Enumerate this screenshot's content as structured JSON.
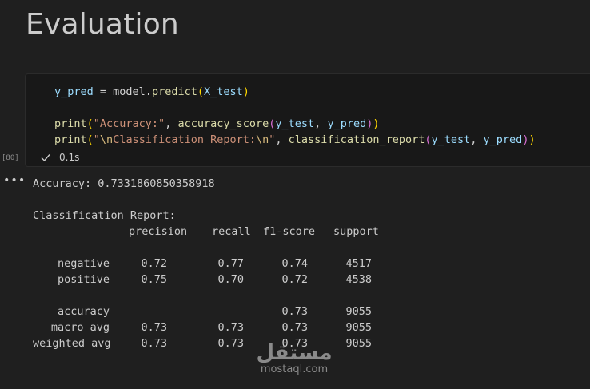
{
  "heading": "Evaluation",
  "cell": {
    "code_lines": [
      [
        [
          "var",
          "y_pred"
        ],
        [
          "txt",
          " = model."
        ],
        [
          "fn",
          "predict"
        ],
        [
          "p1",
          "("
        ],
        [
          "var",
          "X_test"
        ],
        [
          "p1",
          ")"
        ]
      ],
      [],
      [
        [
          "fn",
          "print"
        ],
        [
          "p1",
          "("
        ],
        [
          "str",
          "\"Accuracy:\""
        ],
        [
          "txt",
          ", "
        ],
        [
          "fn",
          "accuracy_score"
        ],
        [
          "p2",
          "("
        ],
        [
          "var",
          "y_test"
        ],
        [
          "txt",
          ", "
        ],
        [
          "var",
          "y_pred"
        ],
        [
          "p2",
          ")"
        ],
        [
          "p1",
          ")"
        ]
      ],
      [
        [
          "fn",
          "print"
        ],
        [
          "p1",
          "("
        ],
        [
          "str",
          "\""
        ],
        [
          "esc",
          "\\n"
        ],
        [
          "str",
          "Classification Report:"
        ],
        [
          "esc",
          "\\n"
        ],
        [
          "str",
          "\""
        ],
        [
          "txt",
          ", "
        ],
        [
          "fn",
          "classification_report"
        ],
        [
          "p2",
          "("
        ],
        [
          "var",
          "y_test"
        ],
        [
          "txt",
          ", "
        ],
        [
          "var",
          "y_pred"
        ],
        [
          "p2",
          ")"
        ],
        [
          "p1",
          ")"
        ]
      ]
    ],
    "execution_count": "[80]",
    "duration": "0.1s"
  },
  "output": {
    "accuracy_line": "Accuracy: 0.7331860850358918",
    "report_title": "Classification Report:",
    "headers": [
      "precision",
      "recall",
      "f1-score",
      "support"
    ],
    "rows": [
      {
        "label": "negative",
        "precision": "0.72",
        "recall": "0.77",
        "f1": "0.74",
        "support": "4517"
      },
      {
        "label": "positive",
        "precision": "0.75",
        "recall": "0.70",
        "f1": "0.72",
        "support": "4538"
      }
    ],
    "summary_rows": [
      {
        "label": "accuracy",
        "precision": "",
        "recall": "",
        "f1": "0.73",
        "support": "9055"
      },
      {
        "label": "macro avg",
        "precision": "0.73",
        "recall": "0.73",
        "f1": "0.73",
        "support": "9055"
      },
      {
        "label": "weighted avg",
        "precision": "0.73",
        "recall": "0.73",
        "f1": "0.73",
        "support": "9055"
      }
    ]
  },
  "watermark": {
    "logo_text": "مستقل",
    "site": "mostaql.com"
  }
}
